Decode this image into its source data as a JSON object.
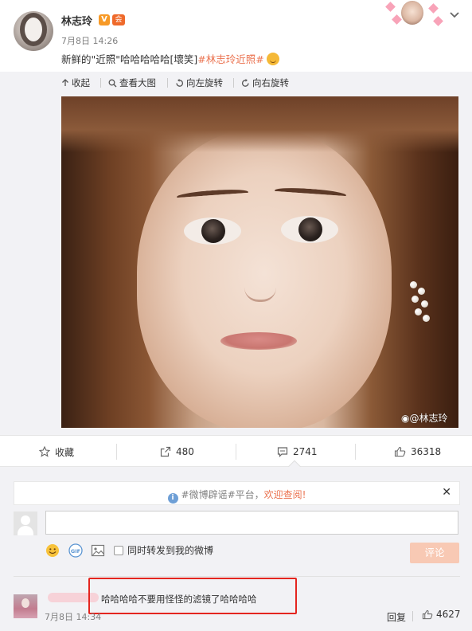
{
  "post": {
    "author": "林志玲",
    "verified_badge": "V",
    "vip_badge": "会员",
    "time": "7月8日 14:26",
    "text_prefix": "新鲜的\"近照\"哈哈哈哈哈[壞笑]",
    "hashtag": "#林志玲近照#"
  },
  "image_toolbar": {
    "collapse": "收起",
    "view_large": "查看大图",
    "rotate_left": "向左旋转",
    "rotate_right": "向右旋转"
  },
  "photo": {
    "watermark": "@林志玲"
  },
  "actions": {
    "favorite": "收藏",
    "repost_count": "480",
    "comment_count": "2741",
    "like_count": "36318"
  },
  "notice": {
    "prefix": "#微博辟谣#平台，",
    "accent": "欢迎查阅!"
  },
  "composer": {
    "repost_label": "同时转发到我的微博",
    "submit": "评论"
  },
  "comment": {
    "text": "哈哈哈哈不要用怪怪的滤镜了哈哈哈哈",
    "time": "7月8日 14:34",
    "reply": "回复",
    "likes": "4627"
  },
  "colors": {
    "accent": "#eb7350",
    "background": "#f2f2f5",
    "highlight_box": "#e4251f",
    "submit_disabled": "#f8c9b4"
  }
}
